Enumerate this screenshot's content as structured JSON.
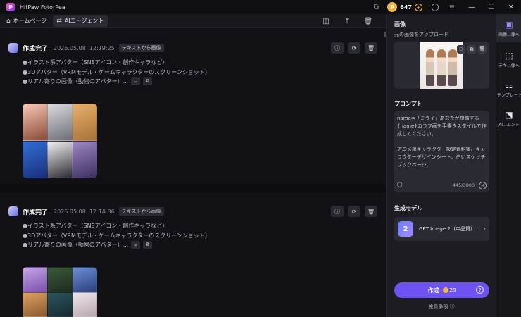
{
  "titlebar": {
    "app_title": "HitPaw FotorPea",
    "logo_letter": "P",
    "coin_count": "647"
  },
  "toolbar": {
    "home_label": "ホームページ",
    "agent_label": "AIエージェント"
  },
  "cards": [
    {
      "status": "作成完了",
      "date": "2026.05.08",
      "time": "12:19:25",
      "tag": "テキストから画像",
      "lines": [
        "●イラスト系アバター（SNSアイコン・創作キャラなど）",
        "●3Dアバター（VRMモデル・ゲームキャラクターのスクリーンショット）",
        "●リアル寄りの画像（動物のアバター）..."
      ]
    },
    {
      "status": "作成完了",
      "date": "2026.05.08",
      "time": "12:14:36",
      "tag": "テキストから画像",
      "lines": [
        "●イラスト系アバター（SNSアイコン・創作キャラなど）",
        "●3Dアバター（VRMモデル・ゲームキャラクターのスクリーンショット）",
        "●リアル寄りの画像（動物のアバター）..."
      ]
    }
  ],
  "panel": {
    "image_title": "画像",
    "image_sub": "元の画像をアップロード",
    "prompt_title": "プロンプト",
    "prompt_text": "name=「ミライ」あなたが想像する{name}のラフ画を手書きスタイルで作成してください。\n\nアニメ風キャラクター設定資料集、キャラクターデザインシート、白いスケッチブックページ、\n\n□　キャラクターの表情や、ポーズ差",
    "prompt_count": "445/3000",
    "model_title": "生成モデル",
    "model_icon_text": "2",
    "model_name": "GPT Image 2: (中品質)...",
    "generate_label": "作成",
    "generate_cost": "28",
    "disclaimer": "免責事項"
  },
  "rail": [
    {
      "label": "画像...像へ"
    },
    {
      "label": "テキ...像へ"
    },
    {
      "label": "テンプレート"
    },
    {
      "label": "AI...エント"
    }
  ],
  "colors": {
    "accent": "#6e52f2",
    "coin": "#f5b73a",
    "background": "#121216",
    "panel": "#1c1c22"
  }
}
